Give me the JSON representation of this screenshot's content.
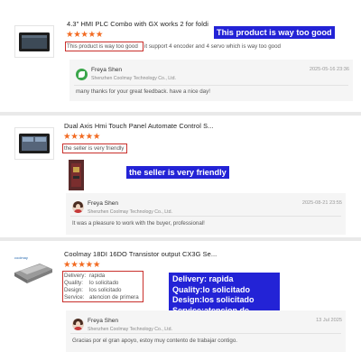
{
  "reviews": [
    {
      "product_title": "4.3\" HMI PLC Combo with GX works 2 for foldi",
      "rating": 5,
      "stars": "★★★★★",
      "highlight_text": "This product is way too good",
      "review_rest": "it support 4 encoder and 4 servo which is way too good",
      "callout": "This product is way too good",
      "reply": {
        "name": "Freya Shen",
        "company": "Shenzhen Coolmay Technology Co., Ltd.",
        "date": "2025-05-16 23:36",
        "message": "many thanks for your great feedback. have a nice day!"
      }
    },
    {
      "product_title": "Dual Axis Hmi Touch Panel Automate Control S...",
      "rating": 5,
      "stars": "★★★★★",
      "highlight_text": "the seller is very friendly",
      "callout": "the seller is very friendly",
      "reply": {
        "name": "Freya Shen",
        "company": "Shenzhen Coolmay Technology Co., Ltd.",
        "date": "2025-08-21 23:55",
        "message": "It was a pleasure to work with the buyer, professional!"
      }
    },
    {
      "product_title": "Coolmay 18DI 16DO Transistor output CX3G Se...",
      "rating": 5,
      "stars": "★★★★★",
      "specs": [
        {
          "label": "Delivery:",
          "value": "rapida"
        },
        {
          "label": "Quality:",
          "value": "lo solicitado"
        },
        {
          "label": "Design:",
          "value": "los solicitado"
        },
        {
          "label": "Service:",
          "value": "atencion de primera"
        }
      ],
      "callout_lines": [
        "Delivery: rapida",
        "Quality:lo solicitado",
        "Design:los solicitado",
        "Service:atencion de primera"
      ],
      "reply": {
        "name": "Freya Shen",
        "company": "Shenzhen Coolmay Technology Co., Ltd.",
        "date": "13 Jul 2025",
        "message": "Gracias por el gran apoyo, estoy muy contento de trabajar contigo."
      }
    }
  ],
  "colors": {
    "callout_bg": "#2323d6",
    "star": "#f26a21",
    "highlight_border": "#c9302c"
  }
}
